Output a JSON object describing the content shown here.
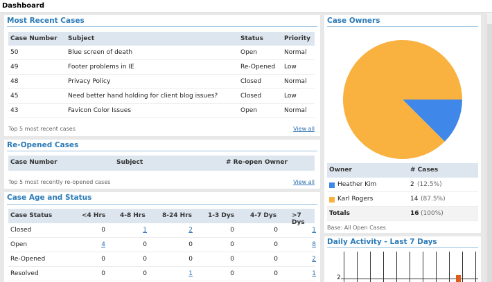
{
  "page": {
    "title": "Dashboard"
  },
  "recent_cases": {
    "title": "Most Recent Cases",
    "headers": {
      "case_number": "Case Number",
      "subject": "Subject",
      "status": "Status",
      "priority": "Priority"
    },
    "rows": [
      {
        "case_number": "50",
        "subject": "Blue screen of death",
        "status": "Open",
        "priority": "Normal"
      },
      {
        "case_number": "49",
        "subject": "Footer problems in IE",
        "status": "Re-Opened",
        "priority": "Low"
      },
      {
        "case_number": "48",
        "subject": "Privacy Policy",
        "status": "Closed",
        "priority": "Normal"
      },
      {
        "case_number": "45",
        "subject": "Need better hand holding for client blog issues?",
        "status": "Closed",
        "priority": "Low"
      },
      {
        "case_number": "43",
        "subject": "Favicon Color Issues",
        "status": "Open",
        "priority": "Normal"
      }
    ],
    "footer": "Top 5 most recent cases",
    "view_all": "View all"
  },
  "reopened_cases": {
    "title": "Re-Opened Cases",
    "headers": {
      "case_number": "Case Number",
      "subject": "Subject",
      "reopen": "# Re-open",
      "owner": "Owner"
    },
    "footer": "Top 5 most recently re-opened cases",
    "view_all": "View all"
  },
  "case_age": {
    "title": "Case Age and Status",
    "headers": {
      "status": "Case Status",
      "c1": "<4 Hrs",
      "c2": "4-8 Hrs",
      "c3": "8-24 Hrs",
      "c4": "1-3 Dys",
      "c5": "4-7 Dys",
      "c6": ">7 Dys"
    },
    "rows": [
      {
        "status": "Closed",
        "c1": "0",
        "c2": "1",
        "c3": "2",
        "c4": "0",
        "c5": "0",
        "c6": "1"
      },
      {
        "status": "Open",
        "c1": "4",
        "c2": "0",
        "c3": "0",
        "c4": "0",
        "c5": "0",
        "c6": "8"
      },
      {
        "status": "Re-Opened",
        "c1": "0",
        "c2": "0",
        "c3": "0",
        "c4": "0",
        "c5": "0",
        "c6": "2"
      },
      {
        "status": "Resolved",
        "c1": "0",
        "c2": "0",
        "c3": "1",
        "c4": "0",
        "c5": "0",
        "c6": "1"
      }
    ]
  },
  "case_owners": {
    "title": "Case Owners",
    "headers": {
      "owner": "Owner",
      "cases": "# Cases"
    },
    "rows": [
      {
        "name": "Heather Kim",
        "count": "2",
        "pct": "(12.5%)",
        "color": "#3f87e8"
      },
      {
        "name": "Karl Rogers",
        "count": "14",
        "pct": "(87.5%)",
        "color": "#f9b23f"
      }
    ],
    "totals": {
      "label": "Totals",
      "count": "16",
      "pct": "(100%)"
    },
    "footer": "Base: All Open Cases"
  },
  "daily_activity": {
    "title": "Daily Activity - Last 7 Days",
    "y_tick": "2"
  },
  "chart_data": [
    {
      "type": "pie",
      "title": "Case Owners",
      "categories": [
        "Heather Kim",
        "Karl Rogers"
      ],
      "values": [
        2,
        14
      ],
      "colors": [
        "#3f87e8",
        "#f9b23f"
      ]
    }
  ]
}
